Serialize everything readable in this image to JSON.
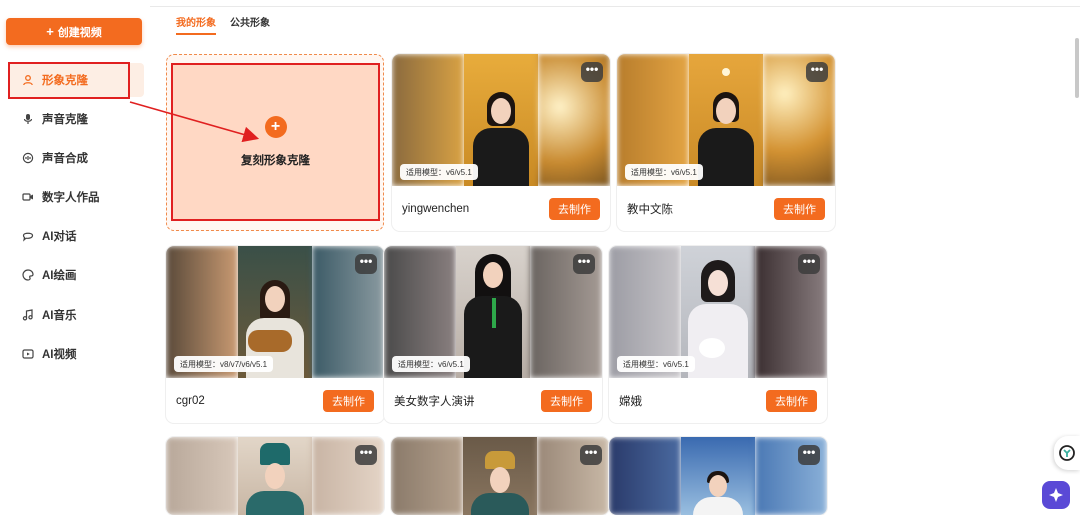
{
  "sidebar": {
    "create_label": "创建视频",
    "items": [
      {
        "label": "形象克隆",
        "icon": "person-icon",
        "active": true
      },
      {
        "label": "声音克隆",
        "icon": "microphone-icon",
        "active": false
      },
      {
        "label": "声音合成",
        "icon": "speech-bubble-icon",
        "active": false
      },
      {
        "label": "数字人作品",
        "icon": "video-camera-icon",
        "active": false
      },
      {
        "label": "AI对话",
        "icon": "chat-icon",
        "active": false
      },
      {
        "label": "AI绘画",
        "icon": "palette-icon",
        "active": false
      },
      {
        "label": "AI音乐",
        "icon": "music-note-icon",
        "active": false
      },
      {
        "label": "AI视频",
        "icon": "video-icon",
        "active": false
      }
    ]
  },
  "tabs": [
    {
      "label": "我的形象",
      "active": true
    },
    {
      "label": "公共形象",
      "active": false
    }
  ],
  "clone_card": {
    "label": "复刻形象克隆"
  },
  "make_label": "去制作",
  "more_label": "•••",
  "cards": [
    {
      "name": "yingwenchen",
      "model": "适用模型：v6/v5.1"
    },
    {
      "name": "教中文陈",
      "model": "适用模型：v6/v5.1"
    },
    {
      "name": "cgr02",
      "model": "适用模型：v8/v7/v6/v5.1"
    },
    {
      "name": "美女数字人演讲",
      "model": "适用模型：v6/v5.1"
    },
    {
      "name": "嫦娥",
      "model": "适用模型：v6/v5.1"
    },
    {
      "name": "",
      "model": ""
    },
    {
      "name": "",
      "model": ""
    },
    {
      "name": "",
      "model": ""
    }
  ],
  "colors": {
    "accent": "#f36b1f",
    "annotation": "#e02020"
  }
}
